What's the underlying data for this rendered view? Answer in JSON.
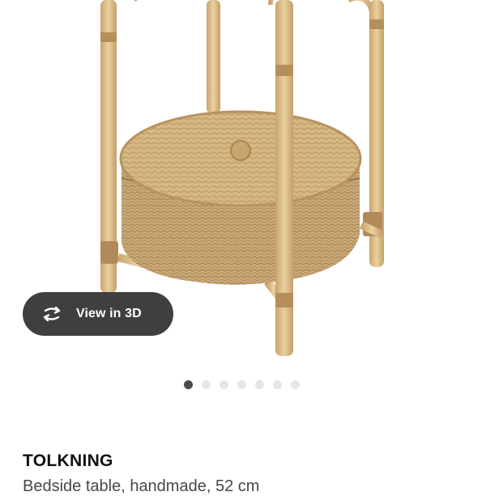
{
  "gallery": {
    "view_3d_label": "View in 3D",
    "dots": [
      true,
      false,
      false,
      false,
      false,
      false,
      false
    ]
  },
  "product": {
    "name": "TOLKNING",
    "description": "Bedside table, handmade, 52 cm"
  },
  "colors": {
    "rattan": "#d7b683",
    "wicker": "#c9a777",
    "button_bg": "#3f3f3f",
    "active_dot": "#4b4b4b",
    "inactive_dot": "#e6e6e6"
  }
}
